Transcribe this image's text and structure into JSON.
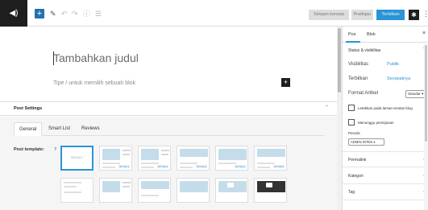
{
  "toolbar": {
    "undo_icon": "undo-icon",
    "redo_icon": "redo-icon",
    "info_icon": "info-icon",
    "outline_icon": "list-view-icon",
    "add_symbol": "+",
    "save_draft": "Simpan konsep",
    "preview": "Pratinjau",
    "publish": "Terbitkan",
    "accent": "#2a94d6"
  },
  "editor": {
    "title_placeholder": "Tambahkan judul",
    "block_placeholder": "Tipe / untuk memilih sebuah blok"
  },
  "post_settings": {
    "title": "Post Settings",
    "tabs": [
      "General",
      "Smart List",
      "Reviews"
    ],
    "active_tab": "General",
    "template_label": "Post template:",
    "help": "?",
    "templates": [
      {
        "label": "DEFAULT",
        "selected": true
      },
      {
        "label": "STYLE 1"
      },
      {
        "label": "STYLE 2"
      },
      {
        "label": "STYLE 3"
      },
      {
        "label": "STYLE 4"
      },
      {
        "label": "STYLE 5"
      },
      {
        "label": ""
      },
      {
        "label": ""
      },
      {
        "label": ""
      },
      {
        "label": ""
      },
      {
        "label": ""
      },
      {
        "label": ""
      }
    ]
  },
  "sidebar": {
    "tab_post": "Pos",
    "tab_block": "Blok",
    "close": "×",
    "status_section": "Status & visibilitas",
    "visibility_label": "Visibilitas",
    "visibility_value": "Publik",
    "publish_label": "Terbitkan",
    "publish_value": "Secepatnya",
    "format_label": "Format Artikel",
    "format_value": "Standar",
    "stick_label": "Letakkan pada laman teratas blog",
    "pending_label": "Menunggu peninjauan",
    "author_label": "Penulis",
    "author_value": "ADMIN INTEN",
    "sections": [
      "Permalink",
      "Kategori",
      "Tag"
    ]
  }
}
